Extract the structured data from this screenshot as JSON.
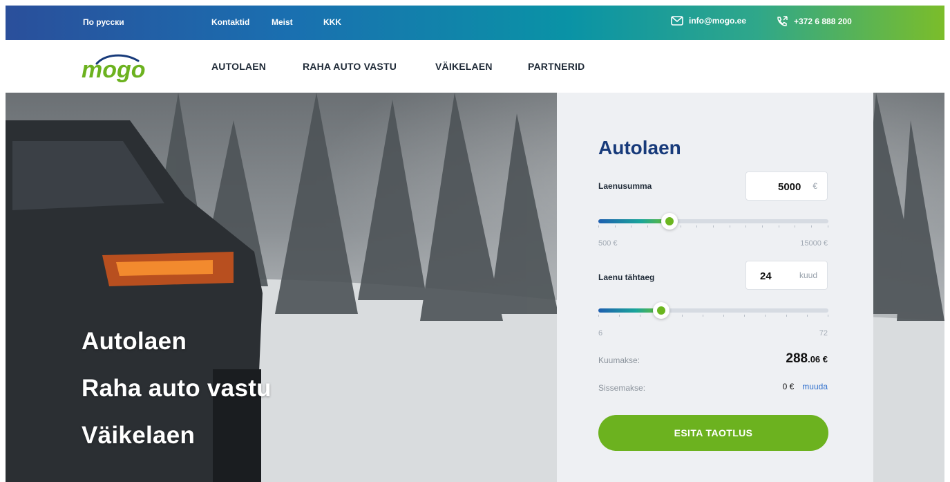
{
  "topbar": {
    "lang_label": "По русски",
    "links": [
      "Kontaktid",
      "Meist",
      "KKK"
    ],
    "email": "info@mogo.ee",
    "phone": "+372 6 888 200",
    "icons": {
      "email": "mail-icon",
      "phone": "phone-icon"
    }
  },
  "nav": {
    "logo_text": "mogo",
    "items": [
      "AUTOLAEN",
      "RAHA AUTO VASTU",
      "VÄIKELAEN",
      "PARTNERID"
    ]
  },
  "hero": {
    "lines": [
      "Autolaen",
      "Raha auto vastu",
      "Väikelaen"
    ]
  },
  "calculator": {
    "title": "Autolaen",
    "amount": {
      "label": "Laenusumma",
      "value": "5000",
      "unit": "€",
      "min_label": "500 €",
      "max_label": "15000 €",
      "min": 500,
      "max": 15000,
      "current": 5000
    },
    "term": {
      "label": "Laenu tähtaeg",
      "value": "24",
      "unit": "kuud",
      "min_label": "6",
      "max_label": "72",
      "min": 6,
      "max": 72,
      "current": 24
    },
    "monthly": {
      "label": "Kuumakse:",
      "whole": "288",
      "decimals": ".06 €"
    },
    "downpayment": {
      "label": "Sissemakse:",
      "value": "0 €",
      "change_link": "muuda"
    },
    "submit_label": "ESITA TAOTLUS"
  },
  "colors": {
    "brand_green": "#6cb21f",
    "brand_blue": "#173a7a",
    "link_blue": "#2f6fcc"
  }
}
